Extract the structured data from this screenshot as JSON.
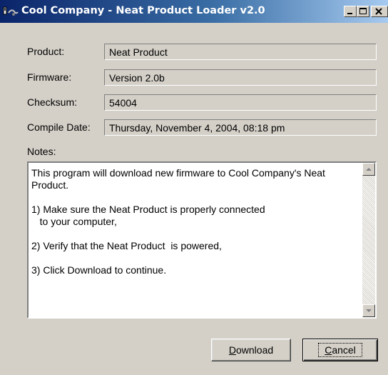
{
  "window": {
    "title": "Cool Company - Neat Product Loader v2.0",
    "title_bar_colors": [
      "#0a246a",
      "#a6caf0"
    ]
  },
  "titlebar_icons": [
    "app-icon",
    "minimize-icon",
    "maximize-icon",
    "close-icon"
  ],
  "fields": {
    "product": {
      "label": "Product:",
      "value": "Neat Product"
    },
    "firmware": {
      "label": "Firmware:",
      "value": "Version 2.0b"
    },
    "checksum": {
      "label": "Checksum:",
      "value": "54004"
    },
    "compile_date": {
      "label": "Compile Date:",
      "value": "Thursday, November 4, 2004, 08:18 pm"
    }
  },
  "notes": {
    "label": "Notes:",
    "lines": [
      "This program will download new firmware to Cool Company's Neat",
      "Product.",
      "",
      "1) Make sure the Neat Product is properly connected",
      "   to your computer,",
      "",
      "2) Verify that the Neat Product  is powered,",
      "",
      "3) Click Download to continue."
    ]
  },
  "buttons": {
    "download": {
      "mnemonic": "D",
      "rest": "ownload"
    },
    "cancel": {
      "mnemonic": "C",
      "rest": "ancel"
    }
  }
}
